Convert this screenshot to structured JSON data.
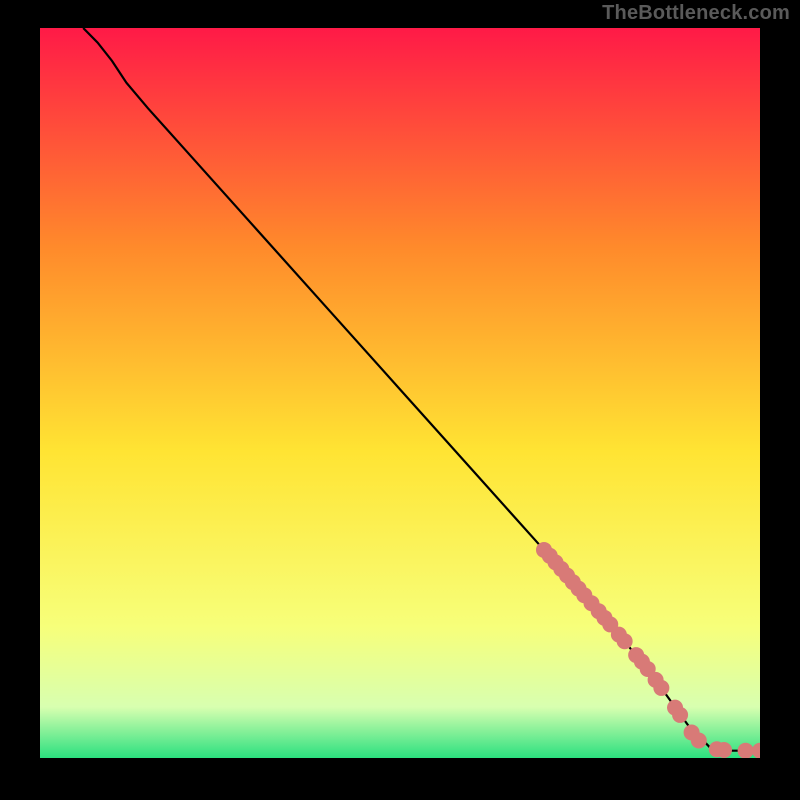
{
  "watermark": "TheBottleneck.com",
  "chart_data": {
    "type": "line",
    "title": "",
    "xlabel": "",
    "ylabel": "",
    "xlim": [
      0,
      100
    ],
    "ylim": [
      0,
      100
    ],
    "grid": false,
    "legend": false,
    "gradient_colors": {
      "top": "#ff1a47",
      "upper_mid": "#ff8a2b",
      "mid": "#ffe433",
      "lower_mid": "#f7ff7a",
      "low_band": "#d8ffb0",
      "bottom": "#2be07f"
    },
    "series": [
      {
        "name": "curve",
        "color": "#000000",
        "x": [
          6,
          8,
          10,
          12,
          15,
          20,
          30,
          40,
          50,
          60,
          70,
          80,
          86,
          90,
          93,
          96,
          100
        ],
        "y": [
          100,
          98,
          95.5,
          92.5,
          89,
          83.5,
          72.5,
          61.5,
          50.5,
          39.5,
          28.5,
          17.5,
          10,
          4.5,
          1.5,
          1,
          1
        ]
      }
    ],
    "marker_points": {
      "color": "#d87a77",
      "radius_px": 8,
      "points": [
        {
          "x": 70.0,
          "y": 28.5
        },
        {
          "x": 70.8,
          "y": 27.7
        },
        {
          "x": 71.6,
          "y": 26.8
        },
        {
          "x": 72.4,
          "y": 25.9
        },
        {
          "x": 73.2,
          "y": 25.0
        },
        {
          "x": 74.0,
          "y": 24.1
        },
        {
          "x": 74.8,
          "y": 23.2
        },
        {
          "x": 75.6,
          "y": 22.3
        },
        {
          "x": 76.6,
          "y": 21.2
        },
        {
          "x": 77.6,
          "y": 20.1
        },
        {
          "x": 78.4,
          "y": 19.2
        },
        {
          "x": 79.2,
          "y": 18.3
        },
        {
          "x": 80.4,
          "y": 16.9
        },
        {
          "x": 81.2,
          "y": 16.0
        },
        {
          "x": 82.8,
          "y": 14.1
        },
        {
          "x": 83.6,
          "y": 13.2
        },
        {
          "x": 84.4,
          "y": 12.2
        },
        {
          "x": 85.5,
          "y": 10.7
        },
        {
          "x": 86.3,
          "y": 9.6
        },
        {
          "x": 88.2,
          "y": 6.9
        },
        {
          "x": 88.9,
          "y": 5.9
        },
        {
          "x": 90.5,
          "y": 3.5
        },
        {
          "x": 91.5,
          "y": 2.4
        },
        {
          "x": 94.0,
          "y": 1.2
        },
        {
          "x": 95.0,
          "y": 1.1
        },
        {
          "x": 98.0,
          "y": 1.0
        },
        {
          "x": 100.0,
          "y": 1.0
        }
      ]
    }
  }
}
